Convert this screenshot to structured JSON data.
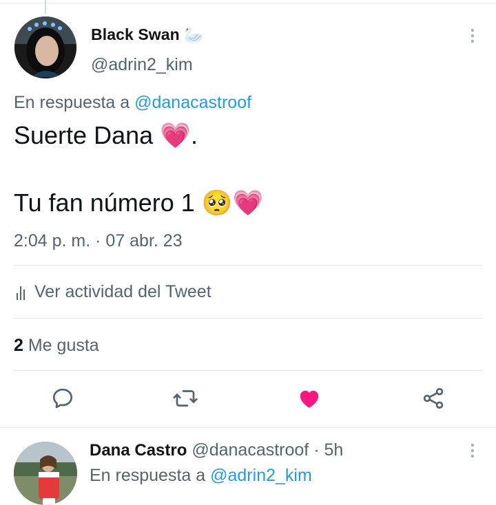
{
  "tweet": {
    "author_name": "Black Swan",
    "author_emoji": "🦢",
    "author_handle": "@adrin2_kim",
    "reply_prefix": "En respuesta a",
    "reply_handle": "@danacastroof",
    "text_line1": "Suerte Dana",
    "text_line1_emoji": "💗",
    "text_line1_end": ".",
    "text_line2": "Tu fan número 1",
    "text_line2_emojis": "🥺💗",
    "timestamp": "2:04 p. m. · 07 abr. 23",
    "activity_label": "Ver actividad del Tweet",
    "likes_count": "2",
    "likes_label": "Me gusta",
    "liked": true
  },
  "actions": [
    {
      "name": "reply",
      "icon": "reply-icon"
    },
    {
      "name": "retweet",
      "icon": "retweet-icon"
    },
    {
      "name": "like",
      "icon": "heart-icon"
    },
    {
      "name": "share",
      "icon": "share-icon"
    }
  ],
  "reply_tweet": {
    "author_name": "Dana Castro",
    "author_handle": "@danacastroof",
    "separator": "·",
    "time": "5h",
    "reply_prefix": "En respuesta a",
    "reply_handle": "@adrin2_kim"
  },
  "colors": {
    "link": "#1d9bf0",
    "like": "#f91880",
    "secondary_text": "#536471",
    "divider": "#dfe6ea"
  }
}
